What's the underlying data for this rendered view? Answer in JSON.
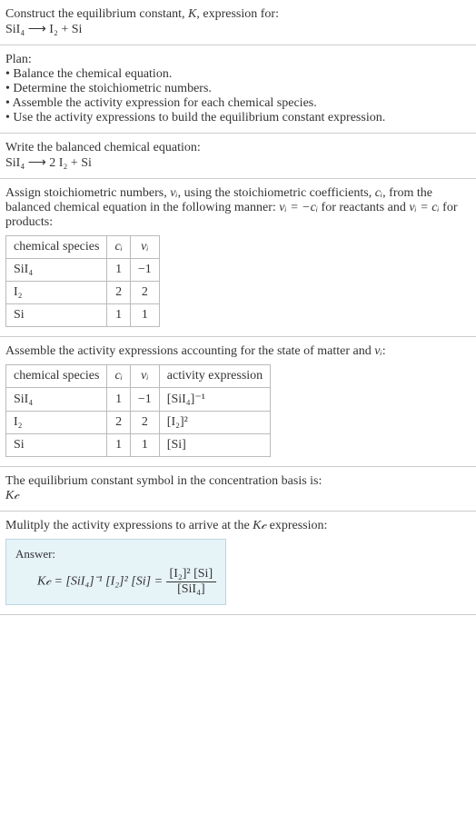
{
  "header": {
    "prompt_prefix": "Construct the equilibrium constant, ",
    "kvar": "K",
    "prompt_suffix": ", expression for:",
    "equation": "SiI₄  ⟶  I₂ + Si"
  },
  "plan": {
    "title": "Plan:",
    "bullets": [
      "• Balance the chemical equation.",
      "• Determine the stoichiometric numbers.",
      "• Assemble the activity expression for each chemical species.",
      "• Use the activity expressions to build the equilibrium constant expression."
    ]
  },
  "balanced": {
    "label": "Write the balanced chemical equation:",
    "equation": "SiI₄  ⟶  2 I₂ + Si"
  },
  "stoich": {
    "intro_a": "Assign stoichiometric numbers, ",
    "nu": "νᵢ",
    "intro_b": ", using the stoichiometric coefficients, ",
    "ci": "cᵢ",
    "intro_c": ", from the balanced chemical equation in the following manner: ",
    "rel1": "νᵢ = −cᵢ",
    "intro_d": " for reactants and ",
    "rel2": "νᵢ = cᵢ",
    "intro_e": " for products:",
    "headers": {
      "species": "chemical species",
      "ci": "cᵢ",
      "nu": "νᵢ"
    },
    "rows": [
      {
        "species": "SiI₄",
        "ci": "1",
        "nu": "−1"
      },
      {
        "species": "I₂",
        "ci": "2",
        "nu": "2"
      },
      {
        "species": "Si",
        "ci": "1",
        "nu": "1"
      }
    ]
  },
  "activity": {
    "intro_a": "Assemble the activity expressions accounting for the state of matter and ",
    "nu": "νᵢ",
    "intro_b": ":",
    "headers": {
      "species": "chemical species",
      "ci": "cᵢ",
      "nu": "νᵢ",
      "act": "activity expression"
    },
    "rows": [
      {
        "species": "SiI₄",
        "ci": "1",
        "nu": "−1",
        "act": "[SiI₄]⁻¹"
      },
      {
        "species": "I₂",
        "ci": "2",
        "nu": "2",
        "act": "[I₂]²"
      },
      {
        "species": "Si",
        "ci": "1",
        "nu": "1",
        "act": "[Si]"
      }
    ]
  },
  "basis": {
    "line": "The equilibrium constant symbol in the concentration basis is:",
    "symbol": "K𝒸"
  },
  "multiply": {
    "line_a": "Mulitply the activity expressions to arrive at the ",
    "kc": "K𝒸",
    "line_b": " expression:"
  },
  "answer": {
    "label": "Answer:",
    "lhs": "K𝒸 = [SiI₄]⁻¹ [I₂]² [Si] = ",
    "num": "[I₂]² [Si]",
    "den": "[SiI₄]"
  }
}
